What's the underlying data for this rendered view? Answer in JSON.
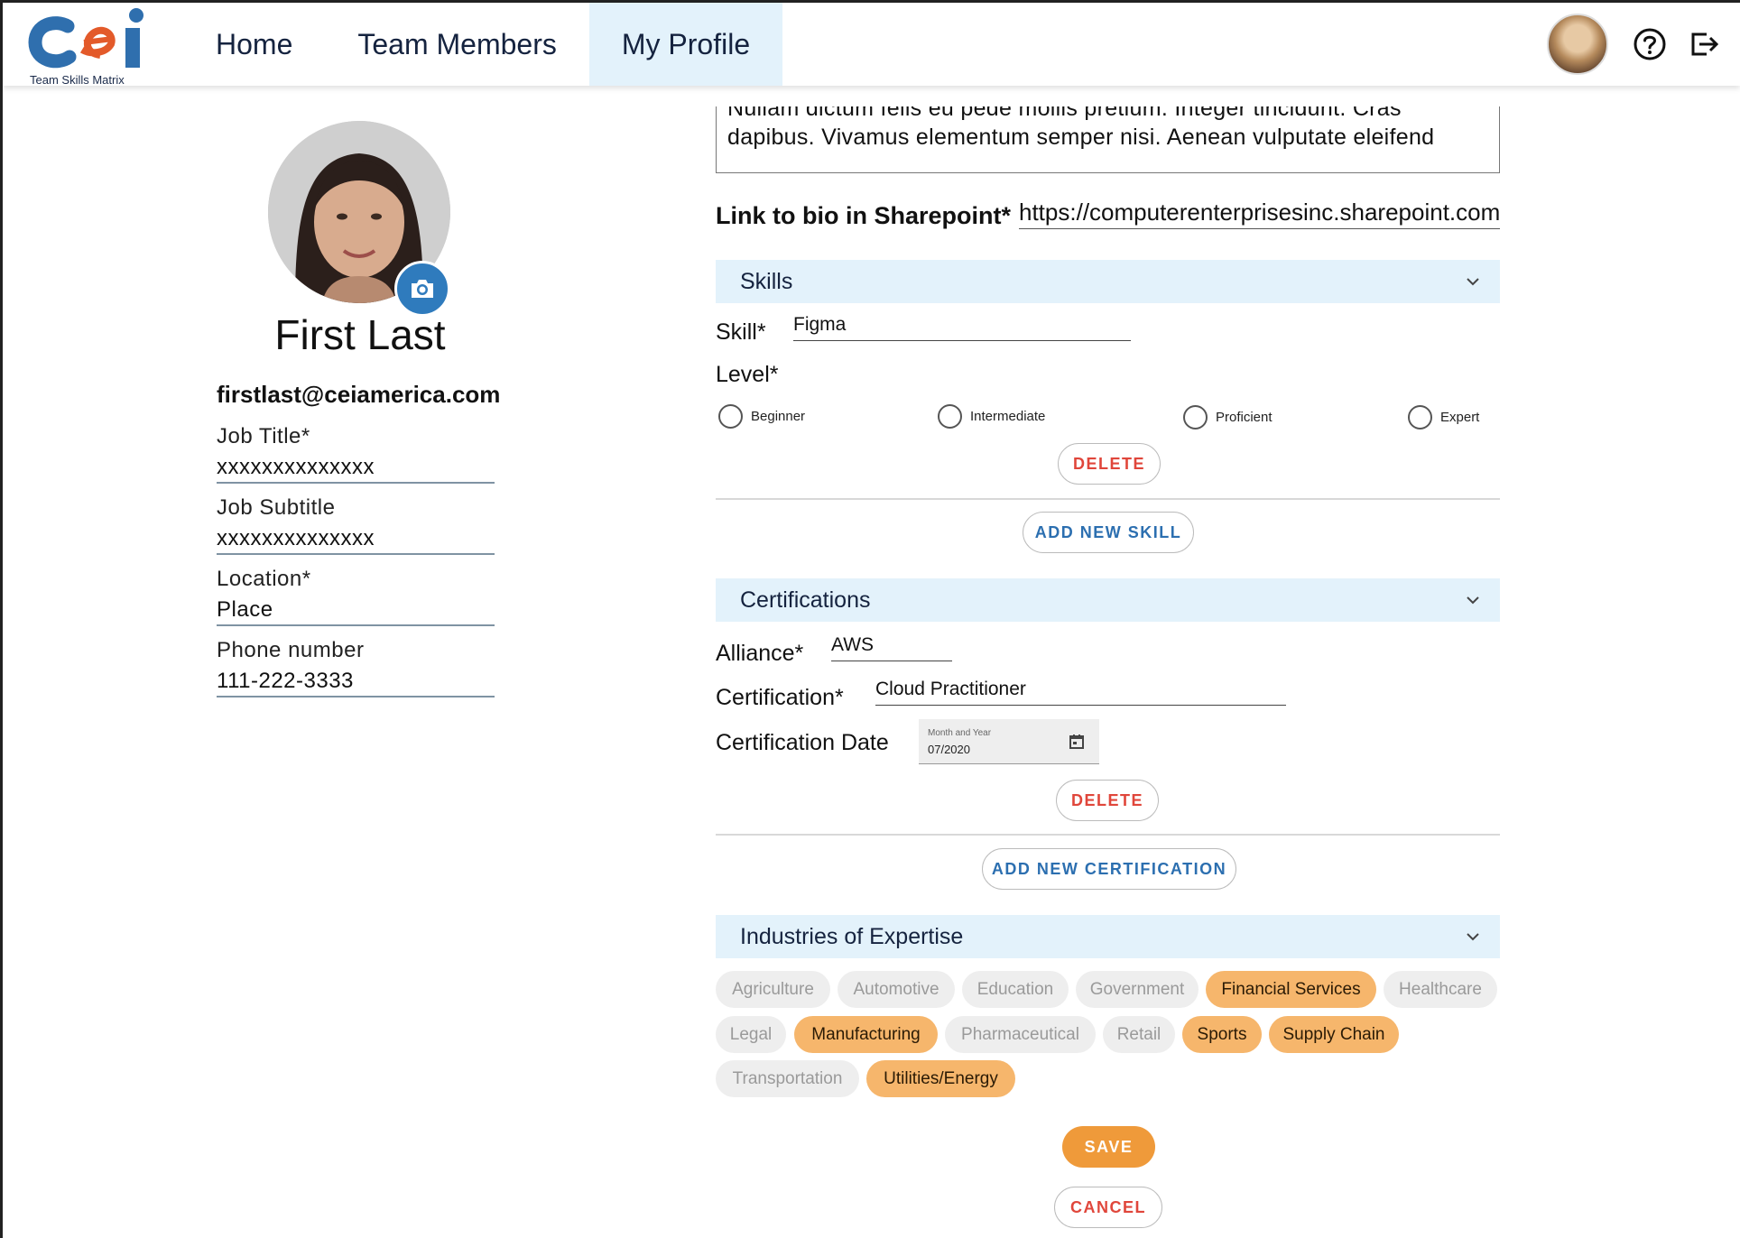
{
  "app": {
    "logo_text": "Team Skills Matrix",
    "accent_color": "#e3f2fb",
    "brand_blue": "#2f7bbd",
    "brand_orange": "#ef9a3a"
  },
  "nav": {
    "items": [
      {
        "label": "Home",
        "active": false
      },
      {
        "label": "Team Members",
        "active": false
      },
      {
        "label": "My Profile",
        "active": true
      }
    ]
  },
  "header_icons": [
    "user-avatar",
    "help-icon",
    "logout-icon"
  ],
  "profile": {
    "name": "First Last",
    "email": "firstlast@ceiamerica.com",
    "fields": [
      {
        "label": "Job Title*",
        "value": "xxxxxxxxxxxxxx"
      },
      {
        "label": "Job Subtitle",
        "value": "xxxxxxxxxxxxxx"
      },
      {
        "label": "Location*",
        "value": "Place"
      },
      {
        "label": "Phone number",
        "value": "111-222-3333"
      }
    ]
  },
  "bio": {
    "text": "Nullam dictum felis eu pede mollis pretium. Integer tincidunt. Cras dapibus. Vivamus elementum semper nisi. Aenean vulputate eleifend",
    "sharepoint_label": "Link to bio in Sharepoint*",
    "sharepoint_value": "https://computerenterprisesinc.sharepoint.com"
  },
  "skills": {
    "title": "Skills",
    "skill_label": "Skill*",
    "skill_value": "Figma",
    "level_label": "Level*",
    "levels": [
      "Beginner",
      "Intermediate",
      "Proficient",
      "Expert"
    ],
    "delete_label": "DELETE",
    "add_label": "ADD NEW SKILL"
  },
  "certifications": {
    "title": "Certifications",
    "alliance_label": "Alliance*",
    "alliance_value": "AWS",
    "cert_label": "Certification*",
    "cert_value": "Cloud Practitioner",
    "date_label": "Certification Date",
    "date_caption": "Month and Year",
    "date_value": "07/2020",
    "delete_label": "DELETE",
    "add_label": "ADD NEW CERTIFICATION"
  },
  "industries": {
    "title": "Industries of Expertise",
    "chips": [
      {
        "label": "Agriculture",
        "selected": false
      },
      {
        "label": "Automotive",
        "selected": false
      },
      {
        "label": "Education",
        "selected": false
      },
      {
        "label": "Government",
        "selected": false
      },
      {
        "label": "Financial Services",
        "selected": true
      },
      {
        "label": "Healthcare",
        "selected": false
      },
      {
        "label": "Legal",
        "selected": false
      },
      {
        "label": "Manufacturing",
        "selected": true
      },
      {
        "label": "Pharmaceutical",
        "selected": false
      },
      {
        "label": "Retail",
        "selected": false
      },
      {
        "label": "Sports",
        "selected": true
      },
      {
        "label": "Supply Chain",
        "selected": true
      },
      {
        "label": "Transportation",
        "selected": false
      },
      {
        "label": "Utilities/Energy",
        "selected": true
      }
    ]
  },
  "actions": {
    "save_label": "SAVE",
    "cancel_label": "CANCEL"
  }
}
